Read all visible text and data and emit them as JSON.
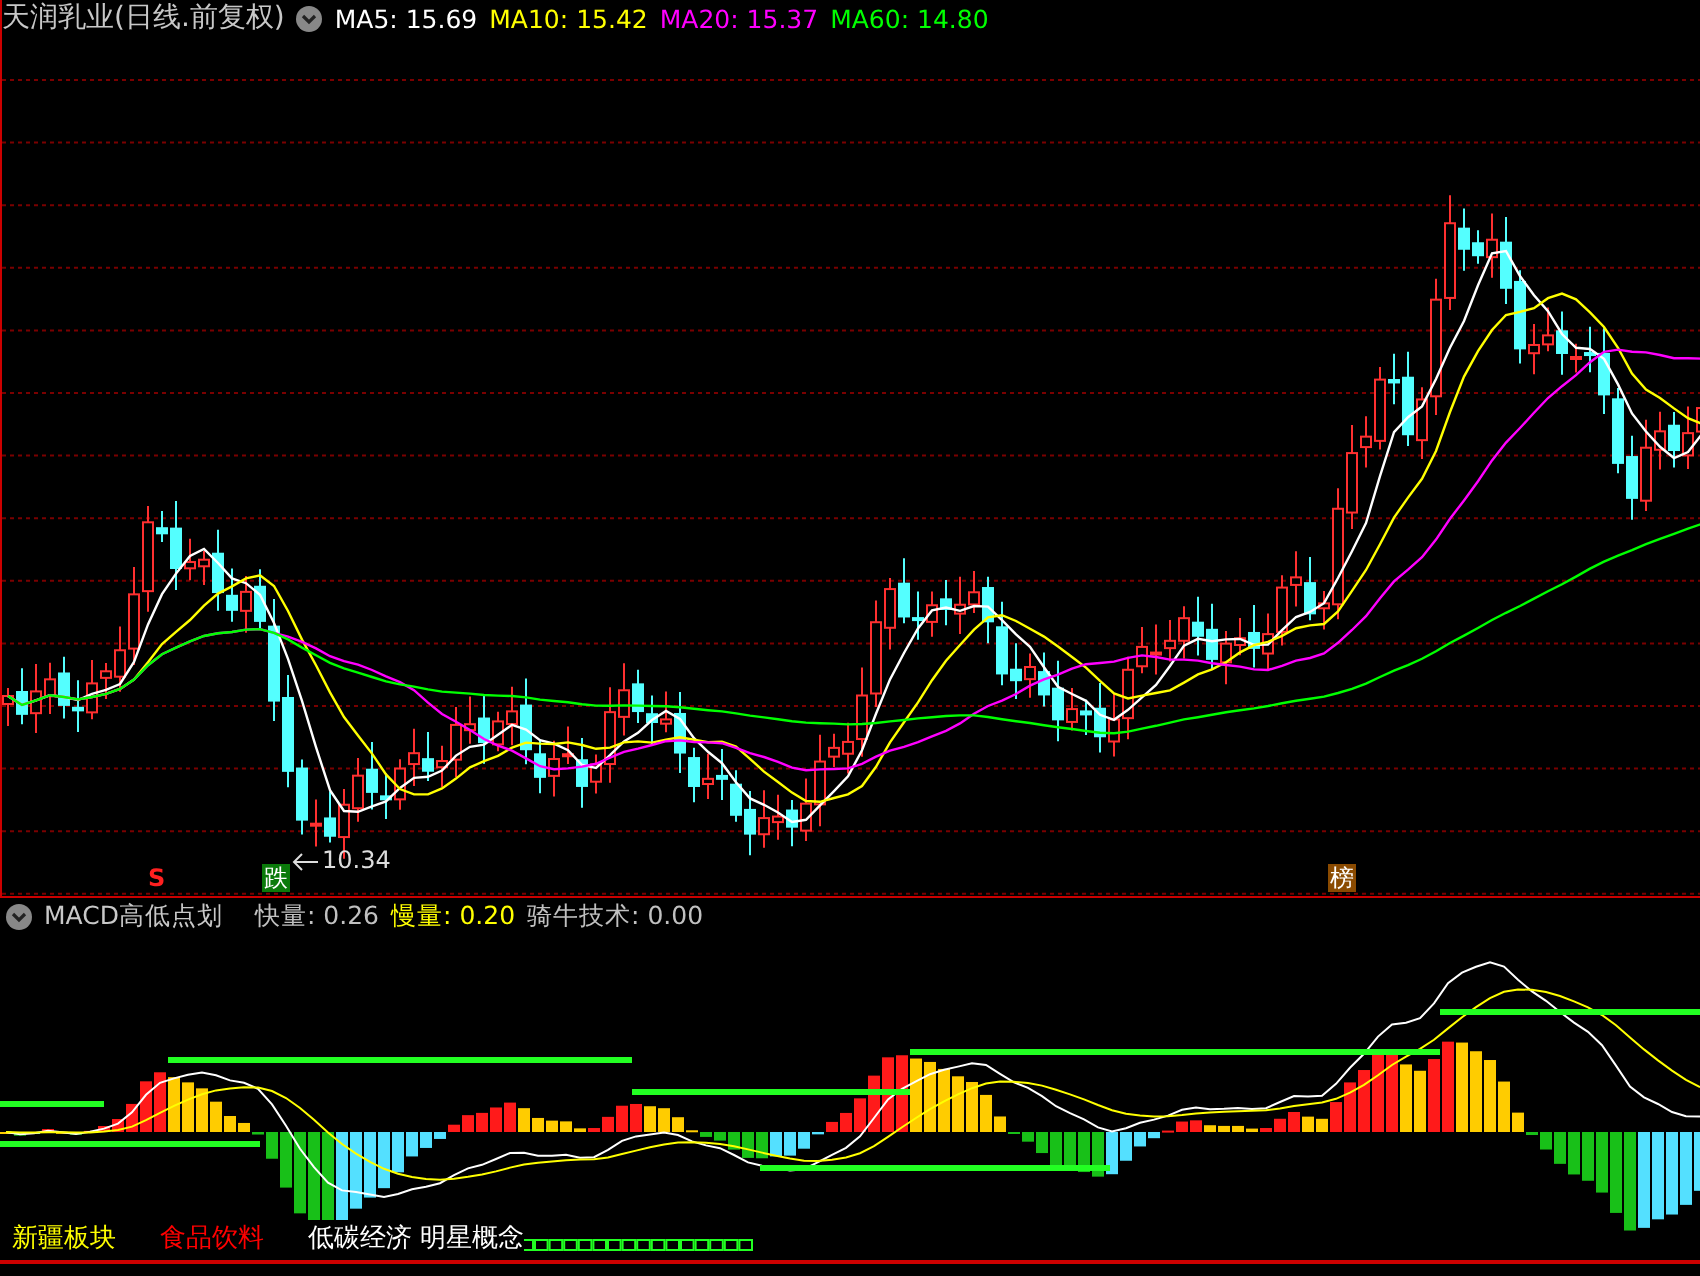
{
  "header": {
    "title": "天润乳业(日线.前复权)",
    "indicators": [
      {
        "label": "MA5: 15.69",
        "color": "#ffffff"
      },
      {
        "label": "MA10: 15.42",
        "color": "#ffff00"
      },
      {
        "label": "MA20: 15.37",
        "color": "#ff00ff"
      },
      {
        "label": "MA60: 14.80",
        "color": "#00ff00"
      }
    ]
  },
  "main_chart": {
    "low_label": "10.34",
    "markers": [
      {
        "kind": "sell",
        "text": "S"
      },
      {
        "kind": "fall",
        "text": "跌"
      },
      {
        "kind": "rank",
        "text": "榜"
      }
    ]
  },
  "macd": {
    "title": "MACD高低点划",
    "values": [
      {
        "label": "快量: 0.26",
        "color": "#c0c0c0"
      },
      {
        "label": "慢量: 0.20",
        "color": "#ffff00"
      },
      {
        "label": "骑牛技术: 0.00",
        "color": "#c0c0c0"
      }
    ]
  },
  "sectors": [
    {
      "text": "新疆板块",
      "color": "#ffff00"
    },
    {
      "text": "食品饮料",
      "color": "#ff0000"
    },
    {
      "text": "低碳经济 明星概念",
      "color": "#ffffff"
    }
  ]
}
